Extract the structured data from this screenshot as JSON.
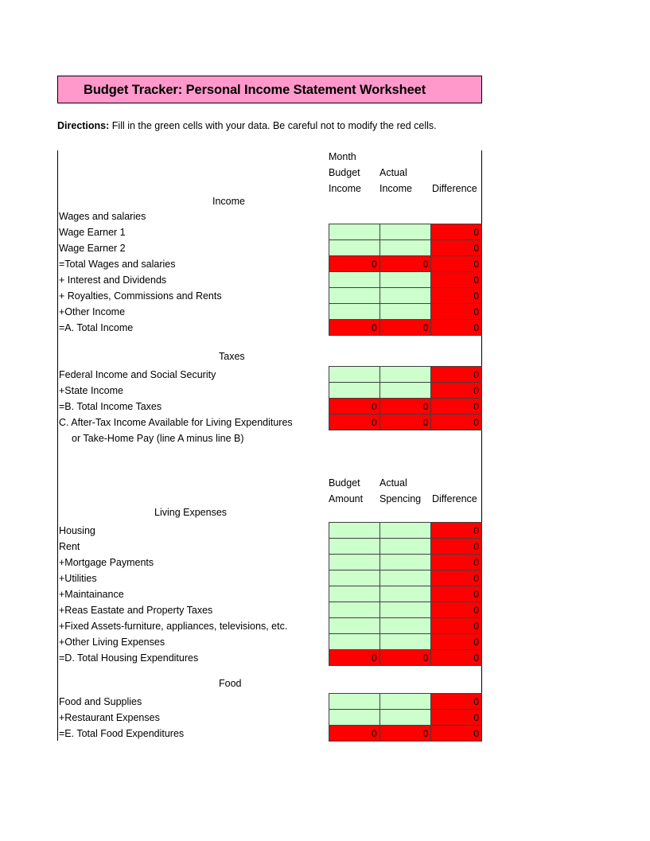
{
  "sheet": {
    "title": "Budget Tracker: Personal Income Statement Worksheet",
    "directions_label": "Directions:",
    "directions_text": "Fill in the green cells with your data.  Be careful not to modify the red cells.",
    "colors": {
      "title_background": "#FF99CC",
      "input_cell": "#CCFFCC",
      "formula_cell": "#FF0000",
      "cell_border": "#404040",
      "text": "#000000"
    }
  },
  "income_header": {
    "line1_col1": "Month",
    "line2_col1": "Budget",
    "line2_col2": "Actual",
    "line3_col1": "Income",
    "line3_col2": "Income",
    "line3_col3": "Difference"
  },
  "expense_header": {
    "line1_col1": "Budget",
    "line1_col2": "Actual",
    "line2_col1": "Amount",
    "line2_col2": "Spencing",
    "line2_col3": "Difference"
  },
  "sections": {
    "income": {
      "title": "Income",
      "rows": [
        {
          "label": "Wages and salaries",
          "type": "heading",
          "budget": "",
          "actual": "",
          "difference": ""
        },
        {
          "label": "Wage Earner 1",
          "type": "input",
          "budget": "",
          "actual": "",
          "difference": "0"
        },
        {
          "label": "Wage Earner 2",
          "type": "input",
          "budget": "",
          "actual": "",
          "difference": "0"
        },
        {
          "label": "=Total Wages and salaries",
          "type": "total",
          "budget": "0",
          "actual": "0",
          "difference": "0"
        },
        {
          "label": "+ Interest and Dividends",
          "type": "input",
          "budget": "",
          "actual": "",
          "difference": "0"
        },
        {
          "label": "+ Royalties, Commissions and Rents",
          "type": "input",
          "budget": "",
          "actual": "",
          "difference": "0"
        },
        {
          "label": "+Other Income",
          "type": "input",
          "budget": "",
          "actual": "",
          "difference": "0"
        },
        {
          "label": "=A.  Total Income",
          "type": "total",
          "budget": "0",
          "actual": "0",
          "difference": "0"
        }
      ]
    },
    "taxes": {
      "title": "Taxes",
      "rows": [
        {
          "label": "Federal Income and Social Security",
          "type": "input",
          "budget": "",
          "actual": "",
          "difference": "0"
        },
        {
          "label": "+State Income",
          "type": "input",
          "budget": "",
          "actual": "",
          "difference": "0"
        },
        {
          "label": "=B.  Total Income Taxes",
          "type": "total",
          "budget": "0",
          "actual": "0",
          "difference": "0"
        },
        {
          "label": "C.  After-Tax Income Available for Living Expenditures",
          "type": "total",
          "budget": "0",
          "actual": "0",
          "difference": "0"
        },
        {
          "label": "or Take-Home Pay (line A minus line B)",
          "type": "note",
          "budget": "",
          "actual": "",
          "difference": ""
        }
      ]
    },
    "living_expenses": {
      "title": "Living Expenses",
      "rows": [
        {
          "label": "Housing",
          "type": "input",
          "budget": "",
          "actual": "",
          "difference": "0"
        },
        {
          "label": "Rent",
          "type": "input",
          "budget": "",
          "actual": "",
          "difference": "0"
        },
        {
          "label": "+Mortgage Payments",
          "type": "input",
          "budget": "",
          "actual": "",
          "difference": "0"
        },
        {
          "label": "+Utilities",
          "type": "input",
          "budget": "",
          "actual": "",
          "difference": "0"
        },
        {
          "label": "+Maintainance",
          "type": "input",
          "budget": "",
          "actual": "",
          "difference": "0"
        },
        {
          "label": "+Reas Eastate and Property Taxes",
          "type": "input",
          "budget": "",
          "actual": "",
          "difference": "0"
        },
        {
          "label": "+Fixed Assets-furniture, appliances, televisions, etc.",
          "type": "input",
          "budget": "",
          "actual": "",
          "difference": "0"
        },
        {
          "label": "+Other Living Expenses",
          "type": "input",
          "budget": "",
          "actual": "",
          "difference": "0"
        },
        {
          "label": "=D.  Total Housing Expenditures",
          "type": "total",
          "budget": "0",
          "actual": "0",
          "difference": "0"
        }
      ]
    },
    "food": {
      "title": "Food",
      "rows": [
        {
          "label": "Food and Supplies",
          "type": "input",
          "budget": "",
          "actual": "",
          "difference": "0"
        },
        {
          "label": "+Restaurant Expenses",
          "type": "input",
          "budget": "",
          "actual": "",
          "difference": "0"
        },
        {
          "label": "=E.  Total Food Expenditures",
          "type": "total",
          "budget": "0",
          "actual": "0",
          "difference": "0"
        }
      ]
    }
  }
}
